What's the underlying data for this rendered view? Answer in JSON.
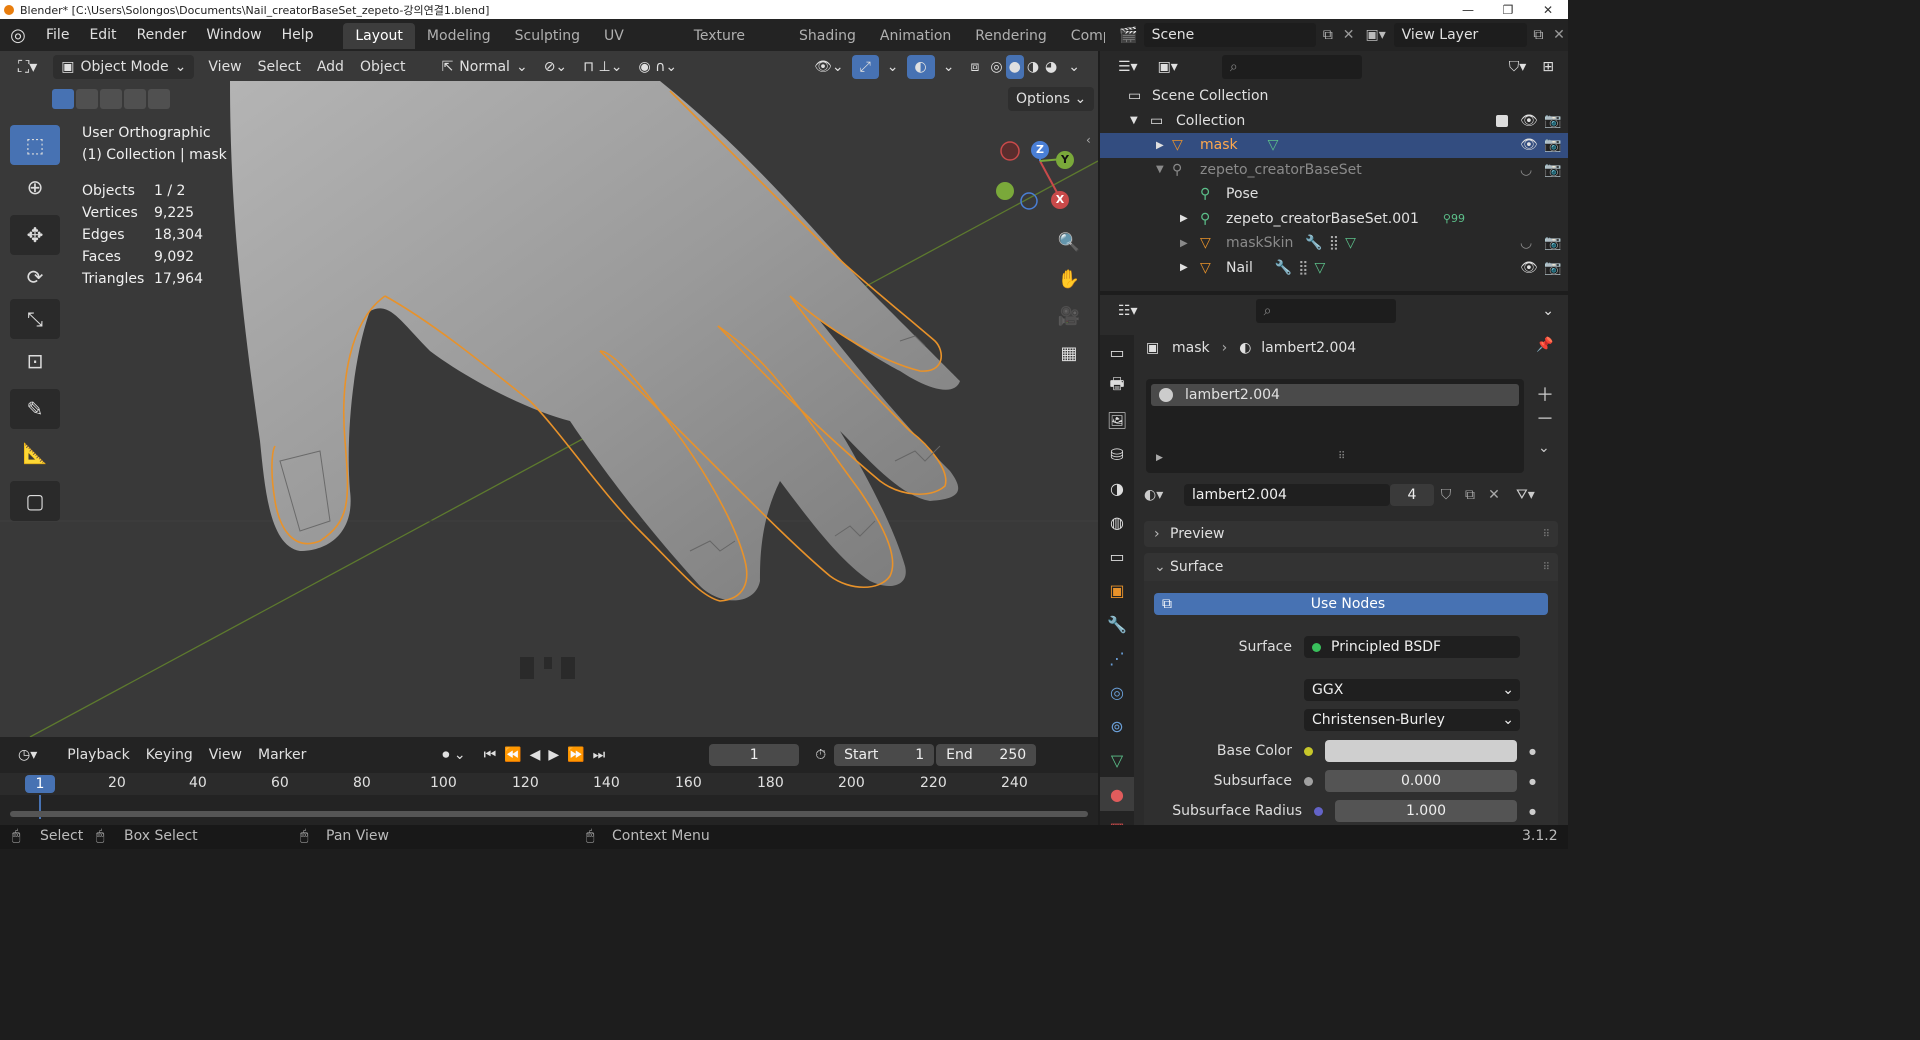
{
  "titlebar": {
    "title": "Blender* [C:\\Users\\Solongos\\Documents\\Nail_creatorBaseSet_zepeto-강의연결1.blend]",
    "minimize": "—",
    "maximize": "❐",
    "close": "✕"
  },
  "menu": [
    "File",
    "Edit",
    "Render",
    "Window",
    "Help"
  ],
  "workspaces": [
    "Layout",
    "Modeling",
    "Sculpting",
    "UV Editing",
    "Texture Paint",
    "Shading",
    "Animation",
    "Rendering",
    "Compo"
  ],
  "active_workspace": "Layout",
  "scene": "Scene",
  "view_layer": "View Layer",
  "viewport": {
    "mode": "Object Mode",
    "menus": [
      "View",
      "Select",
      "Add",
      "Object"
    ],
    "orientation": "Normal",
    "options": "Options",
    "view_name": "User Orthographic",
    "collection_info": "(1) Collection | mask",
    "stats": [
      {
        "label": "Objects",
        "value": "1 / 2"
      },
      {
        "label": "Vertices",
        "value": "9,225"
      },
      {
        "label": "Edges",
        "value": "18,304"
      },
      {
        "label": "Faces",
        "value": "9,092"
      },
      {
        "label": "Triangles",
        "value": "17,964"
      }
    ],
    "gizmo": {
      "z": "Z",
      "y": "Y",
      "x": "X"
    }
  },
  "timeline": {
    "menus": [
      "Playback",
      "Keying",
      "View",
      "Marker"
    ],
    "current_frame": "1",
    "start_label": "Start",
    "start": "1",
    "end_label": "End",
    "end": "250",
    "ticks": [
      "20",
      "40",
      "60",
      "80",
      "100",
      "120",
      "140",
      "160",
      "180",
      "200",
      "220",
      "240"
    ],
    "cursor": "1"
  },
  "outliner": {
    "rows": [
      {
        "label": "Scene Collection",
        "type": "scene"
      },
      {
        "label": "Collection",
        "type": "collection"
      },
      {
        "label": "mask",
        "type": "mesh",
        "selected": true
      },
      {
        "label": "zepeto_creatorBaseSet",
        "type": "armature",
        "dim": true
      },
      {
        "label": "Pose",
        "type": "pose"
      },
      {
        "label": "zepeto_creatorBaseSet.001",
        "type": "armature",
        "extra": "99"
      },
      {
        "label": "maskSkin",
        "type": "mesh",
        "dim": true
      },
      {
        "label": "Nail",
        "type": "mesh"
      }
    ]
  },
  "properties": {
    "breadcrumb_object": "mask",
    "breadcrumb_material": "lambert2.004",
    "slot": "lambert2.004",
    "material_name": "lambert2.004",
    "users": "4",
    "panels": {
      "preview": "Preview",
      "surface": "Surface"
    },
    "use_nodes": "Use Nodes",
    "surface_label": "Surface",
    "surface_value": "Principled BSDF",
    "distribution": "GGX",
    "subsurface_method": "Christensen-Burley",
    "fields": [
      {
        "label": "Base Color",
        "value": "",
        "dot": "#c7c72a"
      },
      {
        "label": "Subsurface",
        "value": "0.000",
        "dot": "#a1a1a1"
      },
      {
        "label": "Subsurface Radius",
        "value": "1.000",
        "dot": "#6363c7"
      }
    ]
  },
  "statusbar": {
    "select": "Select",
    "box_select": "Box Select",
    "pan_view": "Pan View",
    "context_menu": "Context Menu",
    "version": "3.1.2"
  },
  "colors": {
    "accent": "#4772b3",
    "selection_outline": "#e8922a",
    "selected_row": "#334d80"
  }
}
